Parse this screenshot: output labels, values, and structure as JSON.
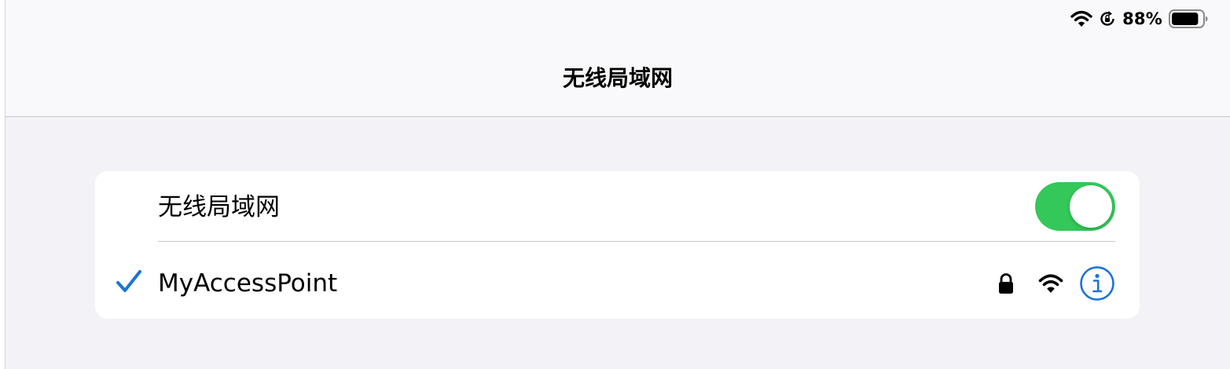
{
  "status_bar": {
    "battery_percent": "88%",
    "battery_level": 0.88,
    "icons": [
      "wifi-icon",
      "orientation-lock-icon",
      "battery-icon"
    ]
  },
  "nav": {
    "title": "无线局域网"
  },
  "wifi_section": {
    "toggle_label": "无线局域网",
    "toggle_on": true,
    "toggle_color": "#34c759"
  },
  "network": {
    "name": "MyAccessPoint",
    "connected": true,
    "secured": true,
    "icons": [
      "checkmark-icon",
      "lock-icon",
      "wifi-signal-icon",
      "info-icon"
    ],
    "accent_color": "#1a73d9"
  }
}
